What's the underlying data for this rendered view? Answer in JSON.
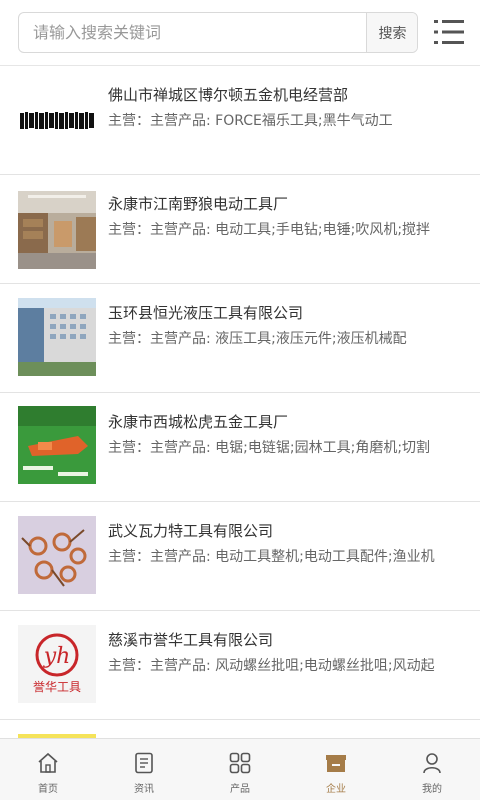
{
  "search": {
    "placeholder": "请输入搜索关键词",
    "button_label": "搜索"
  },
  "companies": [
    {
      "name": "佛山市禅城区博尔顿五金机电经营部",
      "desc": "主营：主营产品: FORCE福乐工具;黑牛气动工"
    },
    {
      "name": "永康市江南野狼电动工具厂",
      "desc": "主营：主营产品: 电动工具;手电钻;电锤;吹风机;搅拌"
    },
    {
      "name": "玉环县恒光液压工具有限公司",
      "desc": "主营：主营产品: 液压工具;液压元件;液压机械配"
    },
    {
      "name": "永康市西城松虎五金工具厂",
      "desc": "主营：主营产品: 电锯;电链锯;园林工具;角磨机;切割"
    },
    {
      "name": "武义瓦力特工具有限公司",
      "desc": "主营：主营产品: 电动工具整机;电动工具配件;渔业机"
    },
    {
      "name": "慈溪市誉华工具有限公司",
      "desc": "主营：主营产品: 风动螺丝批咀;电动螺丝批咀;风动起"
    }
  ],
  "thumb_texts": {
    "logo5": "誉华工具",
    "logo5_mark": "yh"
  },
  "tabs": [
    {
      "label": "首页",
      "icon": "home-icon"
    },
    {
      "label": "资讯",
      "icon": "news-icon"
    },
    {
      "label": "产品",
      "icon": "grid-icon"
    },
    {
      "label": "企业",
      "icon": "store-icon",
      "active": true
    },
    {
      "label": "我的",
      "icon": "user-icon"
    }
  ],
  "colors": {
    "active_tab": "#a57c48",
    "divider": "#e3e3e3"
  }
}
